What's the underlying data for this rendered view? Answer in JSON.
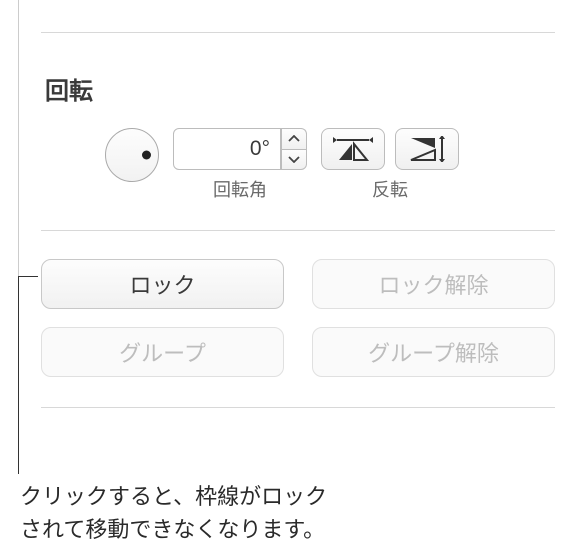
{
  "section": {
    "title": "回転",
    "angle": {
      "value": "0°",
      "label": "回転角"
    },
    "flip": {
      "label": "反転"
    }
  },
  "buttons": {
    "lock": "ロック",
    "unlock": "ロック解除",
    "group": "グループ",
    "ungroup": "グループ解除"
  },
  "callout": "クリックすると、枠線がロック\nされて移動できなくなります。"
}
